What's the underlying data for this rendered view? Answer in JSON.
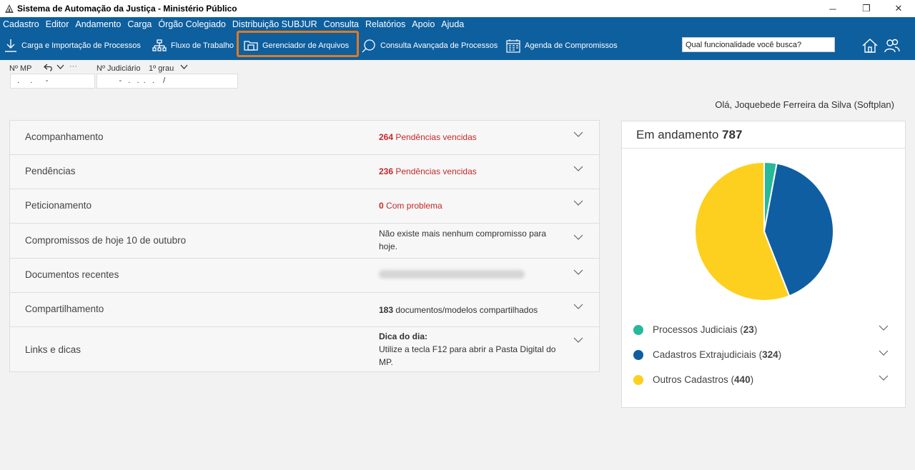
{
  "window": {
    "title": "Sistema de Automação da Justiça - Ministério Público",
    "controls": {
      "minimize": "─",
      "restore": "❐",
      "close": "✕"
    }
  },
  "menu": [
    "Cadastro",
    "Editor",
    "Andamento",
    "Carga",
    "Órgão Colegiado",
    "Distribuição SUBJUR",
    "Consulta",
    "Relatórios",
    "Apoio",
    "Ajuda"
  ],
  "toolbar": {
    "import": "Carga e Importação de Processos",
    "workflow": "Fluxo de Trabalho",
    "file_manager": "Gerenciador de Arquivos",
    "advanced_search": "Consulta Avançada de Processos",
    "agenda": "Agenda de Compromissos",
    "search_value": "Qual funcionalidade você busca?"
  },
  "fields": {
    "mp_label": "Nº MP",
    "mp_value": " .     .      -",
    "judicial_label": "Nº Judiciário",
    "instance": "1º grau",
    "judicial_value": "        -   .   .  .   .    /",
    "more": "···"
  },
  "greeting": "Olá, Joquebede Ferreira da Silva (Softplan)",
  "accordion": [
    {
      "label": "Acompanhamento",
      "count": "264",
      "info": "Pendências vencidas"
    },
    {
      "label": "Pendências",
      "count": "236",
      "info": "Pendências vencidas"
    },
    {
      "label": "Peticionamento",
      "count": "0",
      "info": "Com problema"
    },
    {
      "label": "Compromissos de hoje 10 de outubro",
      "info": "Não existe mais nenhum compromisso para hoje."
    },
    {
      "label": "Documentos recentes"
    },
    {
      "label": "Compartilhamento",
      "count": "183",
      "info": "documentos/modelos compartilhados"
    },
    {
      "label": "Links e dicas",
      "tip_title": "Dica do dia:",
      "tip": "Utilize a tecla F12 para abrir a Pasta Digital do MP."
    }
  ],
  "card": {
    "title": "Em andamento",
    "total": "787"
  },
  "chart_data": {
    "type": "pie",
    "categories": [
      "Processos Judiciais",
      "Cadastros Extrajudiciais",
      "Outros Cadastros"
    ],
    "values": [
      23,
      324,
      440
    ],
    "colors": [
      "#26b99a",
      "#0f5ea1",
      "#fdd020"
    ]
  },
  "legend": [
    {
      "label": "Processos Judiciais",
      "count": "23"
    },
    {
      "label": "Cadastros Extrajudiciais",
      "count": "324"
    },
    {
      "label": "Outros Cadastros",
      "count": "440"
    }
  ]
}
